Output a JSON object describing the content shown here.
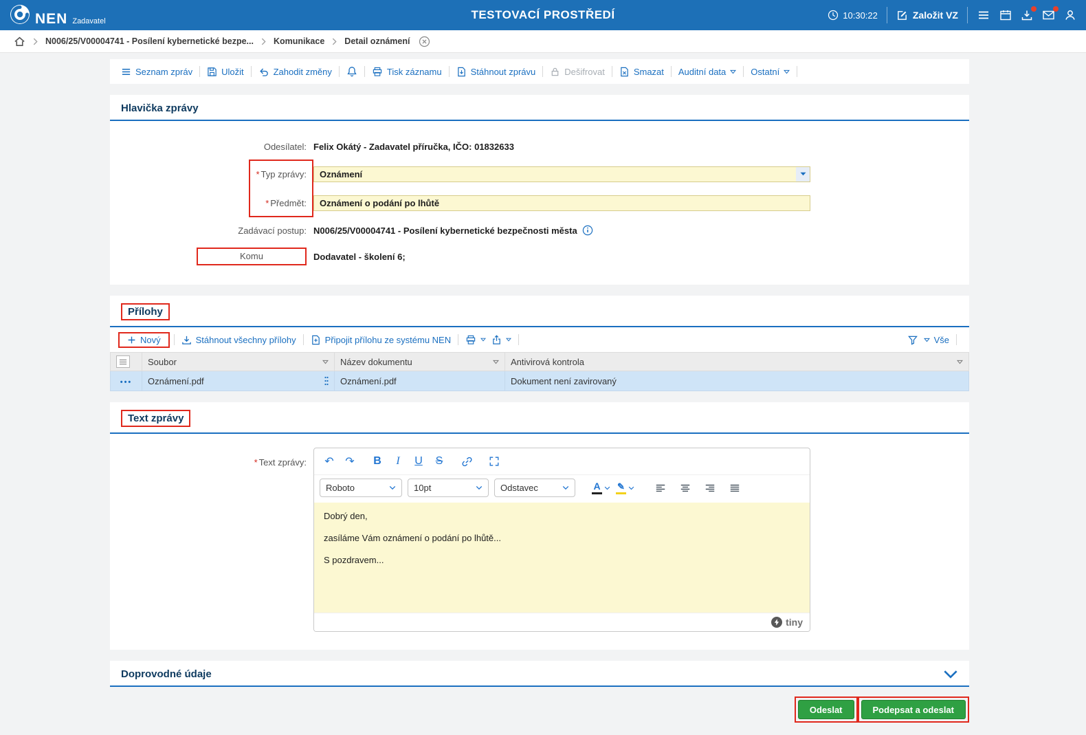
{
  "colors": {
    "header_bg": "#1d70b7",
    "link_blue": "#1a6fc0",
    "section_title": "#0e3a5f",
    "field_yellow": "#fcf8d2",
    "selected_row_blue": "#cfe4f7",
    "annotation_red": "#e0281c",
    "button_green": "#2fa043"
  },
  "header": {
    "logo_text": "NEN",
    "logo_subtitle": "Zadavatel",
    "environment_title": "TESTOVACÍ PROSTŘEDÍ",
    "time": "10:30:22",
    "create_vz_label": "Založit VZ"
  },
  "breadcrumb": {
    "items": [
      {
        "label": "N006/25/V00004741 - Posílení kybernetické bezpe..."
      },
      {
        "label": "Komunikace"
      },
      {
        "label": "Detail oznámení"
      }
    ]
  },
  "toolbar": {
    "items": [
      {
        "label": "Seznam zpráv"
      },
      {
        "label": "Uložit"
      },
      {
        "label": "Zahodit změny"
      },
      {
        "label": "Tisk záznamu"
      },
      {
        "label": "Stáhnout zprávu"
      },
      {
        "label": "Dešifrovat"
      },
      {
        "label": "Smazat"
      },
      {
        "label": "Auditní data"
      },
      {
        "label": "Ostatní"
      }
    ]
  },
  "message_header": {
    "title": "Hlavička zprávy",
    "required_marker": "*",
    "sender_label": "Odesílatel:",
    "sender_value": "Felix Okátý - Zadavatel příručka, IČO: 01832633",
    "type_label": "Typ zprávy:",
    "type_value": "Oznámení",
    "subject_label": "Předmět:",
    "subject_value": "Oznámení o podání po lhůtě",
    "procedure_label": "Zadávací postup:",
    "procedure_value": "N006/25/V00004741 - Posílení kybernetické bezpečnosti města",
    "to_label": "Komu",
    "to_value": "Dodavatel - školení 6;"
  },
  "attachments": {
    "title": "Přílohy",
    "toolbar": {
      "new_label": "Nový",
      "download_all_label": "Stáhnout všechny přílohy",
      "attach_from_nen_label": "Připojit přílohu ze systému NEN",
      "all_label": "Vše"
    },
    "table": {
      "columns": [
        {
          "label": "Soubor"
        },
        {
          "label": "Název dokumentu"
        },
        {
          "label": "Antivirová kontrola"
        }
      ],
      "rows": [
        {
          "file": "Oznámení.pdf",
          "document_name": "Oznámení.pdf",
          "antivirus_status": "Dokument není zavirovaný"
        }
      ]
    }
  },
  "message_text": {
    "title": "Text zprávy",
    "label": "Text zprávy:",
    "editor": {
      "font_name": "Roboto",
      "font_size": "10pt",
      "block_format": "Odstavec",
      "content_lines": [
        "Dobrý den,",
        "zasíláme Vám oznámení o podání po lhůtě...",
        "S pozdravem..."
      ],
      "brand": "tiny"
    }
  },
  "additional_section": {
    "title": "Doprovodné údaje"
  },
  "footer": {
    "send_label": "Odeslat",
    "sign_and_send_label": "Podepsat a odeslat"
  }
}
